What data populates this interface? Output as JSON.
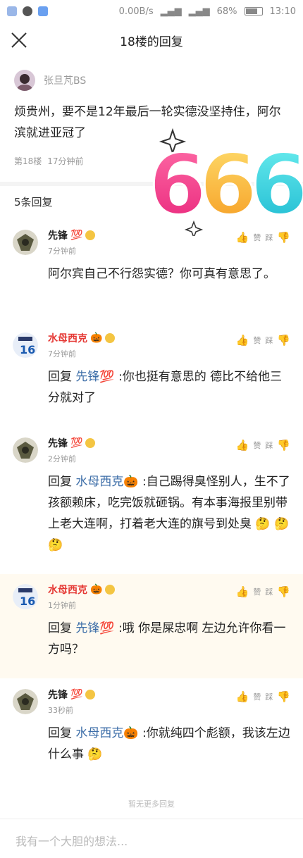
{
  "status_bar": {
    "network_speed": "0.00B/s",
    "battery": "68%",
    "time": "13:10"
  },
  "nav": {
    "title": "18楼的回复"
  },
  "post": {
    "username": "张旦芃BS",
    "text": "烦贵州，要不是12年最后一轮实德没坚持住，阿尔滨就进亚冠了",
    "floor": "第18楼",
    "time": "17分钟前"
  },
  "sticker_text": "666",
  "replies_count": "5条回复",
  "actions": {
    "like": "赞",
    "dislike": "踩"
  },
  "replies": [
    {
      "name": "先锋",
      "badge": "💯",
      "name_color": "#222222",
      "time": "7分钟前",
      "reply_to": "",
      "text": "阿尔宾自己不行怨实德？你可真有意思了。",
      "trailing_emoji": ""
    },
    {
      "name": "水母西克",
      "badge": "🎃",
      "name_color": "#e53935",
      "time": "7分钟前",
      "reply_to": "先锋💯",
      "text": "你也挺有意思的 德比不给他三分就对了",
      "trailing_emoji": ""
    },
    {
      "name": "先锋",
      "badge": "💯",
      "name_color": "#222222",
      "time": "2分钟前",
      "reply_to": "水母西克🎃",
      "text": "自己踢得臭怪别人，生不了孩额赖床，吃完饭就砸锅。有本事海报里别带上老大连啊，打着老大连的旗号到处臭",
      "trailing_emoji": "🤔 🤔 🤔"
    },
    {
      "name": "水母西克",
      "badge": "🎃",
      "name_color": "#e53935",
      "time": "1分钟前",
      "reply_to": "先锋💯",
      "text": "哦 你是屎忠啊 左边允许你看一方吗？",
      "trailing_emoji": ""
    },
    {
      "name": "先锋",
      "badge": "💯",
      "name_color": "#222222",
      "time": "33秒前",
      "reply_to": "水母西克🎃",
      "text": "你就纯四个彪额，我该左边什么事",
      "trailing_emoji": "🤔"
    }
  ],
  "reply_prefix": "回复",
  "no_more": "暂无更多回复",
  "input_placeholder": "我有一个大胆的想法..."
}
